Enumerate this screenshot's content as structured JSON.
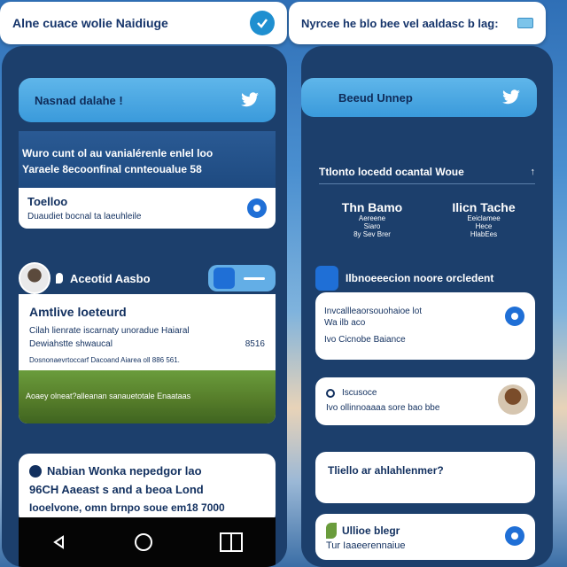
{
  "left": {
    "top_bar_text": "Alne cuace wolie Naidiuge",
    "header_title": "Nasnad dalahe !",
    "banner_text_line1": "Wuro cunt ol au vanialérenle enlel loo",
    "banner_text_line2": "Yaraele 8ecoonfinal cnnteoualue 58",
    "link_row_text": "Toelloo",
    "link_row_sub": "Duaudiet bocnal ta laeuhleile",
    "profile_name": "Aceotid Aasbo",
    "article_title": "Amtlive loeteurd",
    "article_line1": "Cilah lienrate iscarnaty unoradue Haiaral",
    "article_line2": "Dewiahstte shwaucal",
    "article_num": "8516",
    "article_meta": "Dosnonaevrtoccarf Dacoand Aiarea oll 886 561.",
    "image_caption": "Aoaey olneat?alleanan sanauetotale Enaataas",
    "bottom_card_line1": "Nabian Wonka nepedgor lao",
    "bottom_card_line2": "96CH Aaeast s and a beoa Lond",
    "bottom_card_line3": "Iooelvone, omn brnpo soue em18 7000"
  },
  "right": {
    "top_bar_text": "Nyrcee he blo bee vel aaldasc b lag:",
    "header_title": "Beeud Unnep",
    "section_heading": "Ttlonto locedd ocantal Woue",
    "stat1_title": "Thn Bamo",
    "stat1_sub1": "Aereene",
    "stat1_sub2": "Siaro",
    "stat1_sub3": "8y Sev Brer",
    "stat2_title": "Ilicn Tache",
    "stat2_sub1": "Eeiclamee",
    "stat2_sub2": "Hece",
    "stat2_sub3": "HlabEes",
    "notif_heading": "Ilbnoeeecion noore orcledent",
    "card1_line1": "Invcallleaorsouohaioe lot",
    "card1_line2": "Wa ilb aco",
    "card1_line3": "Ivo Cicnobe Baiance",
    "card2_line1": "Iscusoce",
    "card2_line2": "Ivo ollinnoaaaa sore bao bbe",
    "card3_text": "Tliello ar ahlahlenmer?",
    "card4_line1": "Ullioe blegr",
    "card4_line2": "Tur Iaaeerennaiue"
  },
  "colors": {
    "accent_blue": "#3a9adb",
    "phone_bg": "#1c3f6c",
    "dark_text": "#12305f"
  }
}
